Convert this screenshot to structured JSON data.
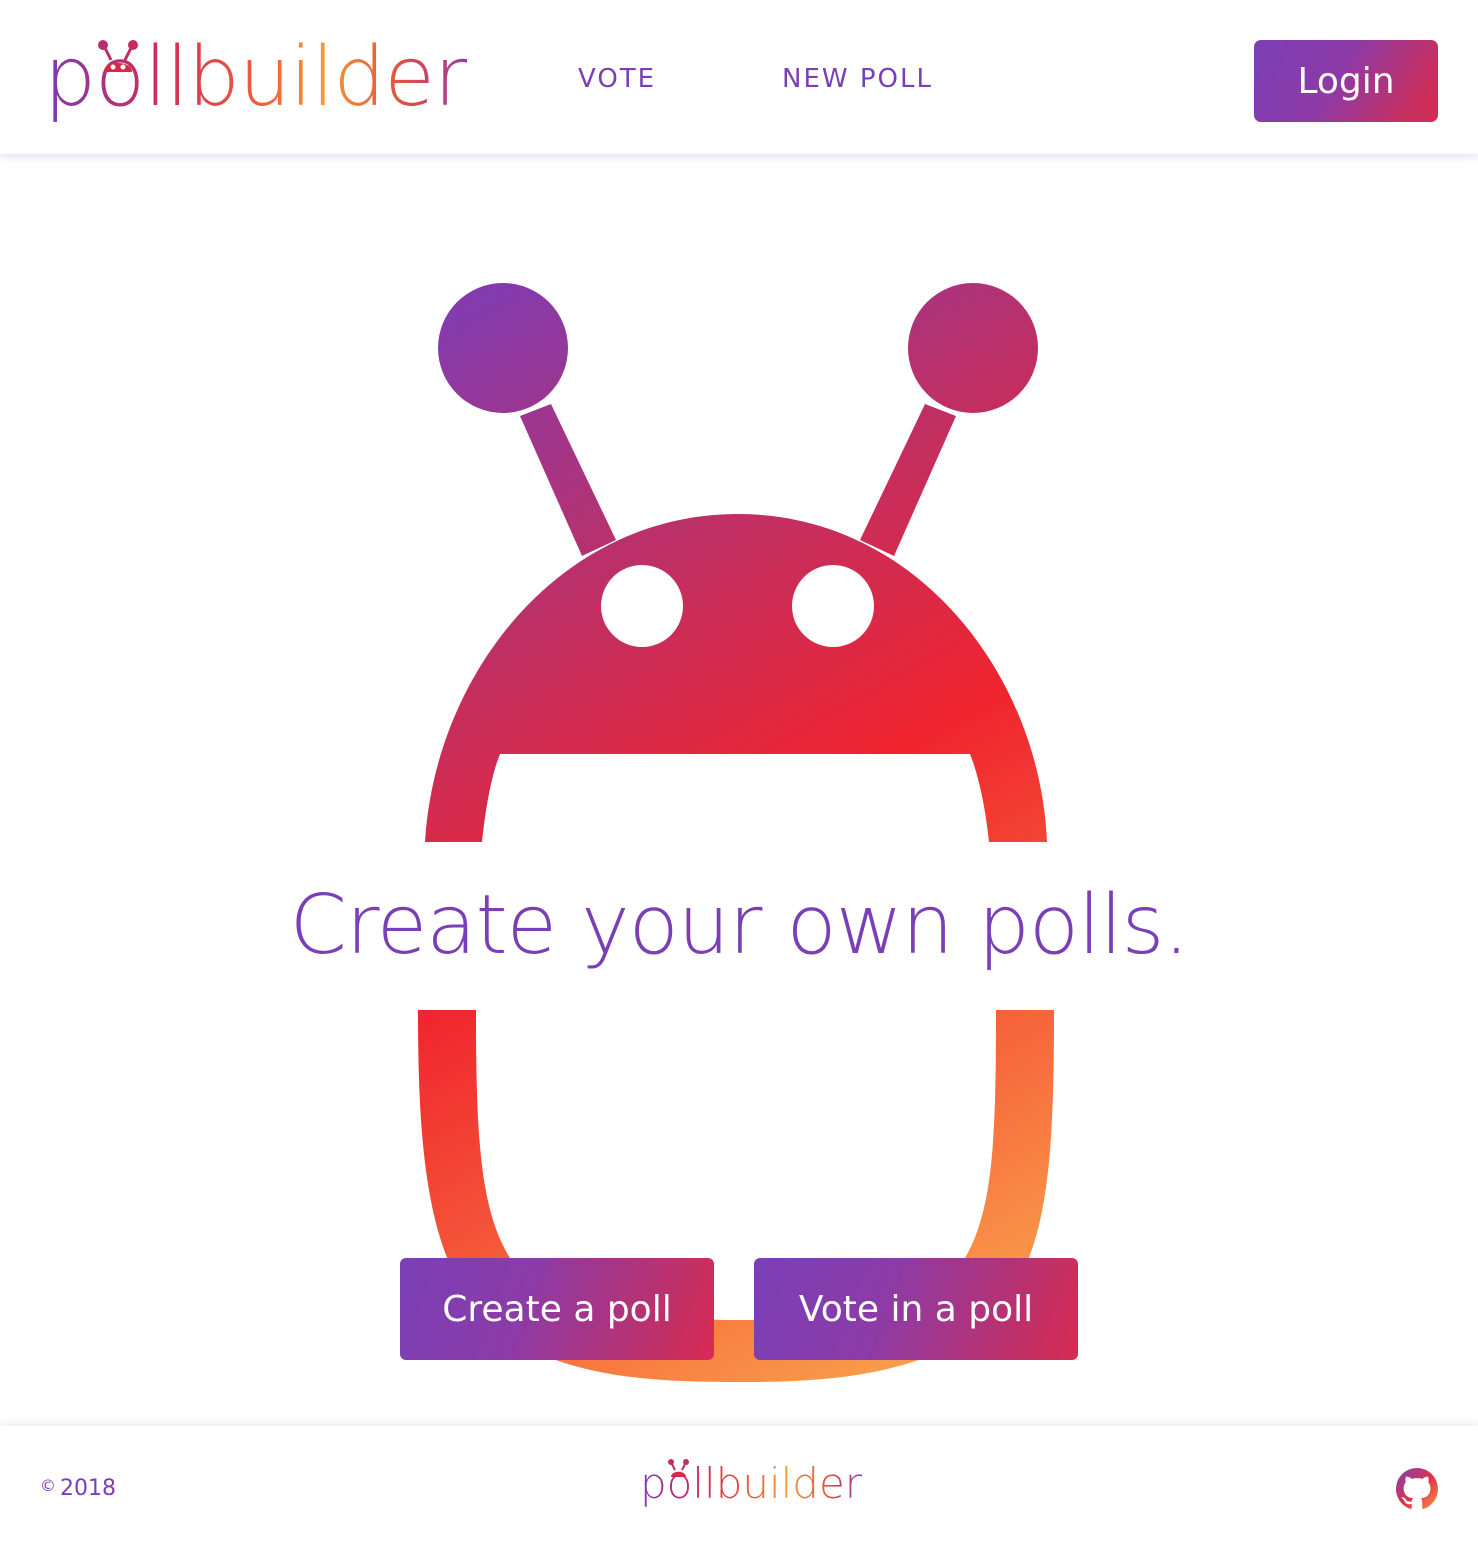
{
  "header": {
    "logo_text": "pollbuilder",
    "nav": {
      "vote_label": "VOTE",
      "new_poll_label": "NEW POLL"
    },
    "login_label": "Login"
  },
  "hero": {
    "title": "Create your own polls.",
    "create_button_label": "Create a poll",
    "vote_button_label": "Vote in a poll"
  },
  "footer": {
    "copyright_symbol": "©",
    "copyright_year": "2018",
    "logo_text": "pollbuilder",
    "github_icon": "github-icon"
  },
  "colors": {
    "brand_purple": "#7a3fb6",
    "brand_red": "#f0242e",
    "brand_orange": "#f7a84a",
    "background": "#ffffff"
  }
}
